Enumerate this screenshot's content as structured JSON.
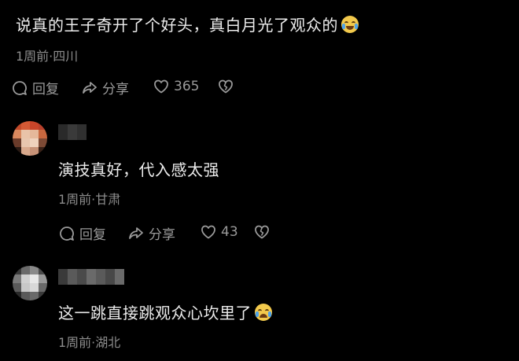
{
  "comment1": {
    "text": "说真的王子奇开了个好头，真白月光了观众的",
    "meta": "1周前·四川",
    "reply_label": "回复",
    "share_label": "分享",
    "like_count": "365"
  },
  "comment2": {
    "text": "演技真好，代入感太强",
    "meta": "1周前·甘肃",
    "reply_label": "回复",
    "share_label": "分享",
    "like_count": "43"
  },
  "comment3": {
    "text": "这一跳直接跳观众心坎里了",
    "meta": "1周前·湖北"
  },
  "colors": {
    "background": "#000000",
    "text": "#ececec",
    "meta": "#8c8c8c",
    "action": "#9a9a9a"
  }
}
